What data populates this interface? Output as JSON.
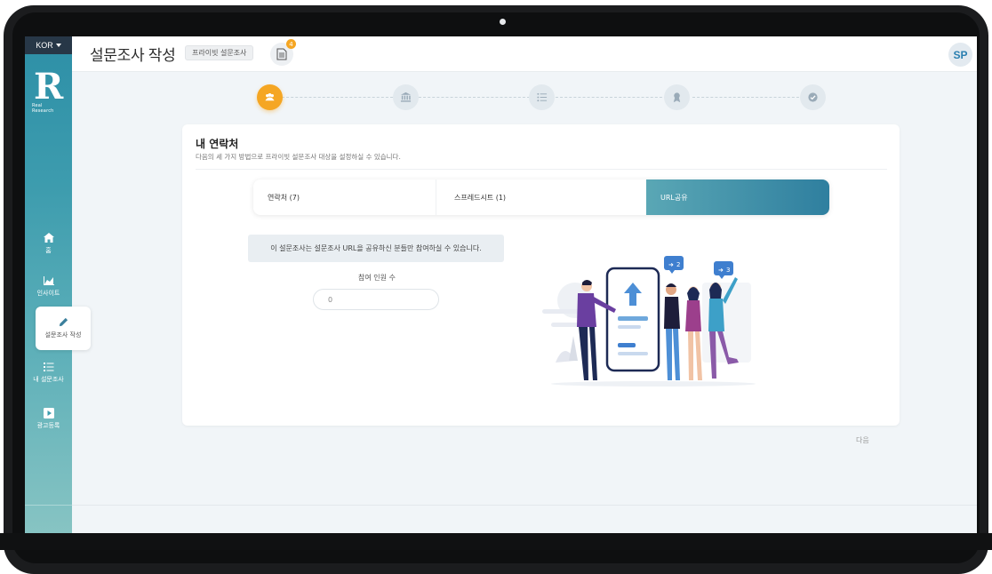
{
  "sidebar": {
    "language": "KOR",
    "logo_text": "R",
    "logo_subtext": "Real Research",
    "items": [
      {
        "label": "홈",
        "icon": "home-icon"
      },
      {
        "label": "인사이트",
        "icon": "chart-icon"
      },
      {
        "label": "설문조사 작성",
        "icon": "pencil-icon",
        "active": true
      },
      {
        "label": "내 설문조사",
        "icon": "list-icon"
      },
      {
        "label": "광고등록",
        "icon": "play-icon"
      }
    ]
  },
  "header": {
    "title": "설문조사 작성",
    "survey_type": "프라이빗 설문조사",
    "doc_count": "4",
    "avatar_initials": "SP"
  },
  "stepper": {
    "steps": [
      "people-icon",
      "bank-icon",
      "list-icon",
      "award-icon",
      "check-icon"
    ],
    "active_index": 0,
    "active_color": "#f5a623"
  },
  "contacts": {
    "title": "내 연락처",
    "subtitle": "다음의 세 가지 방법으로 프라이빗 설문조사 대상을 설정하실 수 있습니다.",
    "tabs": [
      {
        "label": "연락처 (7)"
      },
      {
        "label": "스프레드시트 (1)"
      },
      {
        "label": "URL공유",
        "active": true
      }
    ],
    "notice": "이 설문조사는 설문조사 URL을 공유하신 분들만 참여하실 수 있습니다.",
    "participant_label": "참여 인원 수",
    "participant_value": "0",
    "share_badges": [
      "2",
      "3"
    ]
  },
  "footer": {
    "next_label": "다음"
  },
  "colors": {
    "accent": "#f5a623",
    "primary": "#2f7f9f",
    "sidebar_top": "#2d8fa7",
    "sidebar_bottom": "#87c4c3"
  }
}
